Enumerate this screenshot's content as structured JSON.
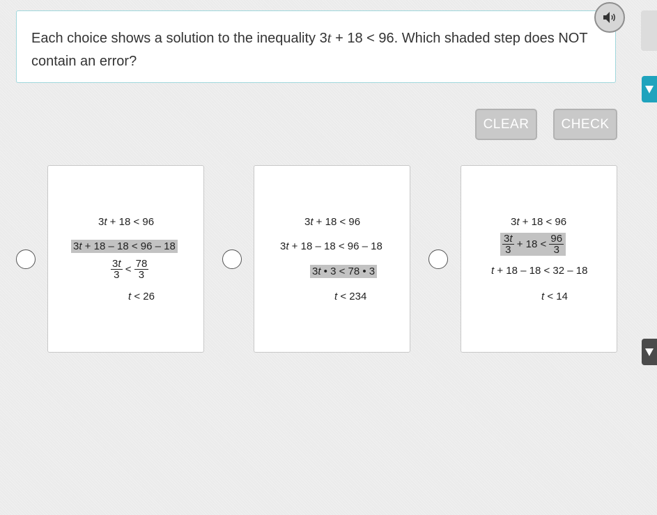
{
  "question": {
    "part1": "Each choice shows a solution to the inequality 3",
    "var": "t",
    "part2": " + 18 < 96. Which shaded step does NOT contain an error?"
  },
  "buttons": {
    "clear": "CLEAR",
    "check": "CHECK"
  },
  "icons": {
    "audio": "speaker-icon",
    "tab_teal": "triangle-down-icon",
    "tab_dark": "triangle-down-icon"
  },
  "colors": {
    "teal": "#1fa3bd",
    "shade": "#c2c2c2",
    "button": "#c9c9c9"
  },
  "choices": [
    {
      "l1a": "3",
      "l1v": "t",
      "l1b": " + 18 < 96",
      "l2a": "3",
      "l2v": "t",
      "l2b": " + 18 – 18 < 96 – 18",
      "f1n1": "3",
      "f1nv": "t",
      "f1d": "3",
      "f1op": "<",
      "f2n": "78",
      "f2d": "3",
      "l4v": "t",
      "l4b": " < 26"
    },
    {
      "l1a": "3",
      "l1v": "t",
      "l1b": " + 18 < 96",
      "l2a": "3",
      "l2v": "t",
      "l2b": " + 18 – 18 < 96 – 18",
      "l3a": "3",
      "l3v": "t",
      "l3b": " • 3 < 78 • 3",
      "l4v": "t",
      "l4b": " < 234"
    },
    {
      "l1a": "3",
      "l1v": "t",
      "l1b": " + 18 < 96",
      "f1n1": "3",
      "f1nv": "t",
      "f1d": "3",
      "mid": "+ 18 <",
      "f2n": "96",
      "f2d": "3",
      "l3v": "t",
      "l3b": " + 18 – 18 < 32 – 18",
      "l4v": "t",
      "l4b": " < 14"
    }
  ]
}
